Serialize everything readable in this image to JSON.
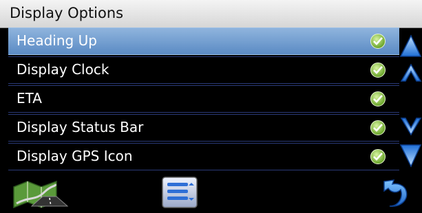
{
  "header": {
    "title": "Display Options"
  },
  "options": [
    {
      "label": "Heading Up",
      "checked": true,
      "selected": true
    },
    {
      "label": "Display Clock",
      "checked": true,
      "selected": false
    },
    {
      "label": "ETA",
      "checked": true,
      "selected": false
    },
    {
      "label": "Display Status Bar",
      "checked": true,
      "selected": false
    },
    {
      "label": "Display GPS Icon",
      "checked": true,
      "selected": false
    }
  ],
  "scrollbar": {
    "buttons": [
      "scroll-top-icon",
      "scroll-up-icon",
      "scroll-down-icon",
      "scroll-bottom-icon"
    ]
  },
  "toolbar": {
    "icons": [
      "map-icon",
      "list-menu-icon",
      "back-arrow-icon"
    ]
  },
  "colors": {
    "selected_row": "#6f9bd0",
    "row_border": "#2a3a78",
    "check_green": "#6ea82f",
    "arrow_blue": "#2f7fe0"
  }
}
